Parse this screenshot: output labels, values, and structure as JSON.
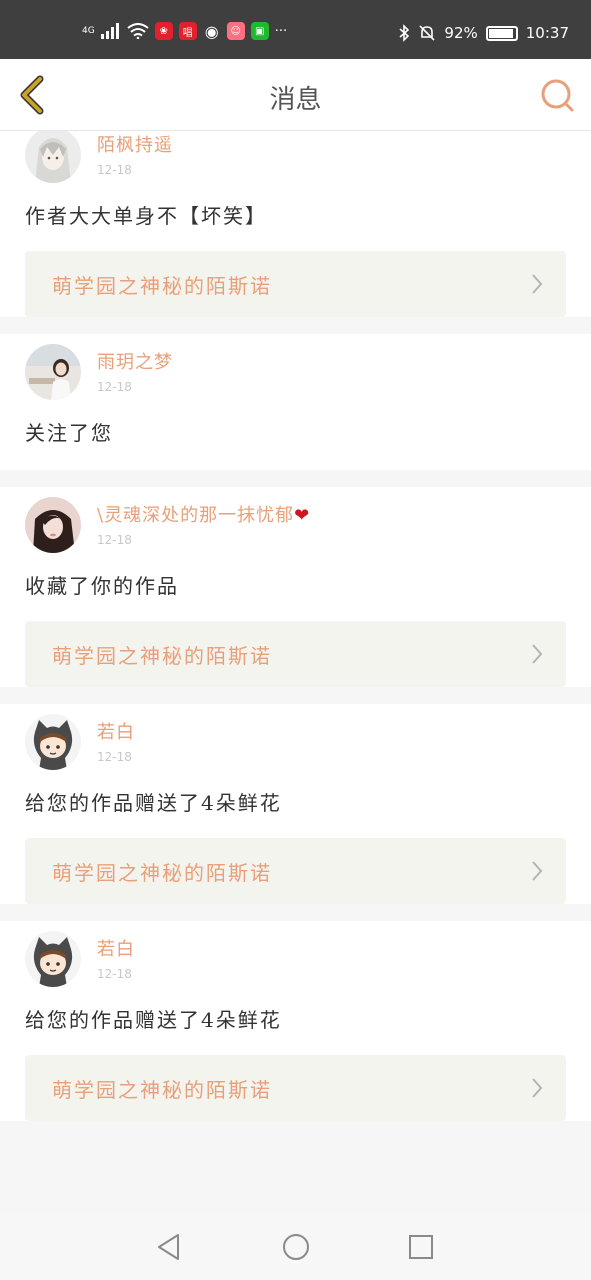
{
  "status_bar": {
    "network": "4G",
    "app_icons": [
      "huawei-icon",
      "sing-app-icon",
      "wechat-icon",
      "pig-app-icon",
      "iqiyi-icon"
    ],
    "more": "···",
    "battery": "92%",
    "battery_level": 0.92,
    "time": "10:37"
  },
  "header": {
    "title": "消息"
  },
  "messages": [
    {
      "name": "陌枫持遥",
      "date": "12-18",
      "text": "作者大大单身不【坏笑】",
      "work": "萌学园之神秘的陌斯诺",
      "avatar": "avatar-silver-hair"
    },
    {
      "name": "雨玥之梦",
      "date": "12-18",
      "text": "关注了您",
      "work": "",
      "avatar": "avatar-girl-desk"
    },
    {
      "name": "\\灵魂深处的那一抹忧郁",
      "name_suffix": "❤",
      "date": "12-18",
      "text": "收藏了你的作品",
      "work": "萌学园之神秘的陌斯诺",
      "avatar": "avatar-girl-photo"
    },
    {
      "name": "若白",
      "date": "12-18",
      "text": "给您的作品赠送了4朵鲜花",
      "work": "萌学园之神秘的陌斯诺",
      "avatar": "avatar-cartoon-cat"
    },
    {
      "name": "若白",
      "date": "12-18",
      "text": "给您的作品赠送了4朵鲜花",
      "work": "萌学园之神秘的陌斯诺",
      "avatar": "avatar-cartoon-cat"
    }
  ],
  "colors": {
    "accent": "#e8a07a",
    "back_arrow": "#c9a227",
    "work_bg": "#f4f4ef"
  }
}
